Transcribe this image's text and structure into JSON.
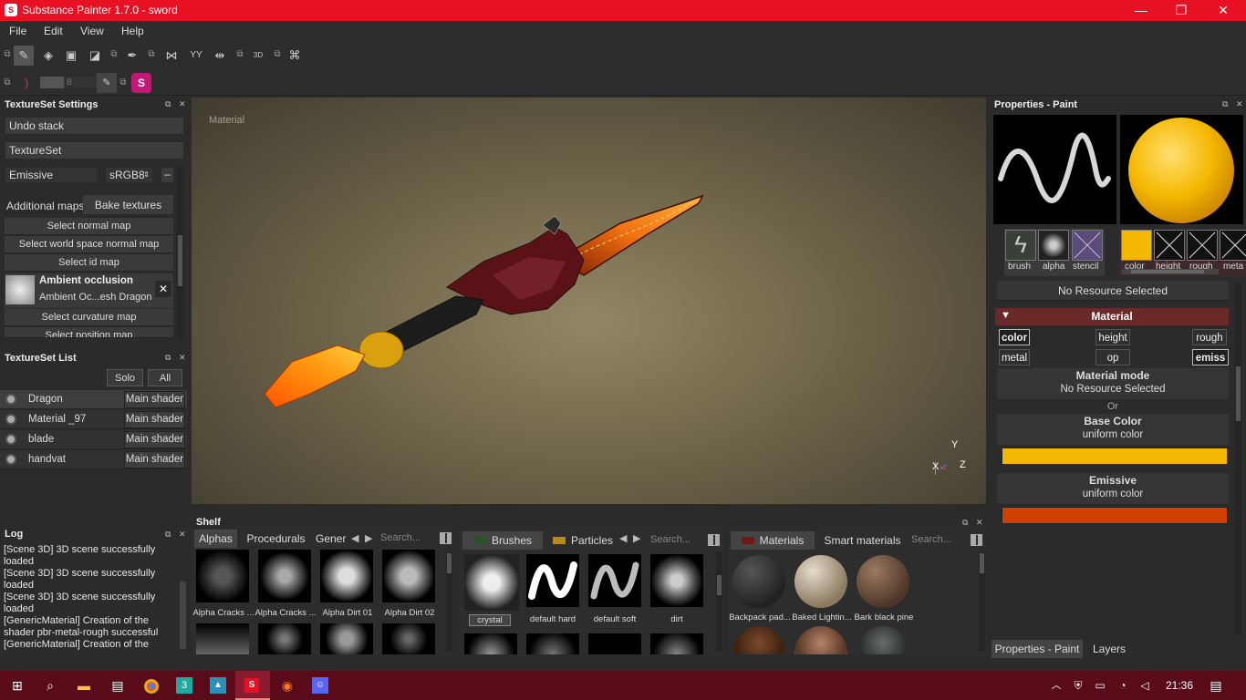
{
  "window": {
    "title": "Substance Painter 1.7.0 - sword",
    "minimize": "—",
    "restore": "❐",
    "close": "✕"
  },
  "menu": {
    "file": "File",
    "edit": "Edit",
    "view": "View",
    "help": "Help"
  },
  "toolbar2": {
    "size_value": "8"
  },
  "textureset_settings": {
    "title": "TextureSet Settings",
    "undo_stack": "Undo stack",
    "textureset": "TextureSet",
    "channel": "Emissive",
    "format": "sRGB8",
    "additional_maps": "Additional maps",
    "bake_textures": "Bake textures",
    "maps": [
      "Select normal map",
      "Select world space normal map",
      "Select id map"
    ],
    "ao_title": "Ambient occlusion",
    "ao_file": "Ambient Oc...esh Dragon",
    "curvature": "Select curvature map",
    "position": "Select position map"
  },
  "textureset_list": {
    "title": "TextureSet List",
    "solo": "Solo",
    "all": "All",
    "items": [
      {
        "name": "Dragon",
        "shader": "Main shader"
      },
      {
        "name": "Material _97",
        "shader": "Main shader"
      },
      {
        "name": "blade",
        "shader": "Main shader"
      },
      {
        "name": "handvat",
        "shader": "Main shader"
      }
    ]
  },
  "log": {
    "title": "Log",
    "lines": [
      "[Scene 3D] 3D scene successfully loaded",
      "[Scene 3D] 3D scene successfully loaded",
      "[Scene 3D] 3D scene successfully loaded",
      "[GenericMaterial] Creation of the shader pbr-metal-rough successful",
      "[GenericMaterial] Creation of the"
    ]
  },
  "viewport": {
    "label": "Material",
    "axis_x": "X",
    "axis_y": "Y",
    "axis_z": "Z"
  },
  "shelf": {
    "title": "Shelf",
    "tabs1": [
      "Alphas",
      "Procedurals",
      "Gener"
    ],
    "search1": "Search...",
    "alphas": [
      "Alpha Cracks ...",
      "Alpha Cracks ...",
      "Alpha Dirt 01",
      "Alpha Dirt 02"
    ],
    "tabs2": [
      "Brushes",
      "Particles"
    ],
    "search2": "Search...",
    "brushes": [
      "crystal",
      "default hard",
      "default soft",
      "dirt"
    ],
    "tabs3": [
      "Materials",
      "Smart materials"
    ],
    "search3": "Search...",
    "materials": [
      "Backpack pad...",
      "Baked Lightin...",
      "Bark black pine"
    ]
  },
  "properties": {
    "title": "Properties - Paint",
    "slots": [
      "brush",
      "alpha",
      "stencil"
    ],
    "channels": [
      "color",
      "height",
      "rough",
      "meta"
    ],
    "no_resource": "No Resource Selected",
    "material": "Material",
    "chan_buttons": [
      "color",
      "height",
      "rough",
      "metal",
      "op",
      "emiss"
    ],
    "material_mode": "Material mode",
    "no_resource2": "No Resource Selected",
    "or": "Or",
    "base_color": "Base Color",
    "uniform1": "uniform color",
    "emissive": "Emissive",
    "uniform2": "uniform color",
    "base_color_hex": "#f5b800",
    "emissive_hex": "#d04000",
    "tab_props": "Properties - Paint",
    "tab_layers": "Layers"
  },
  "taskbar": {
    "time": "21:36"
  }
}
